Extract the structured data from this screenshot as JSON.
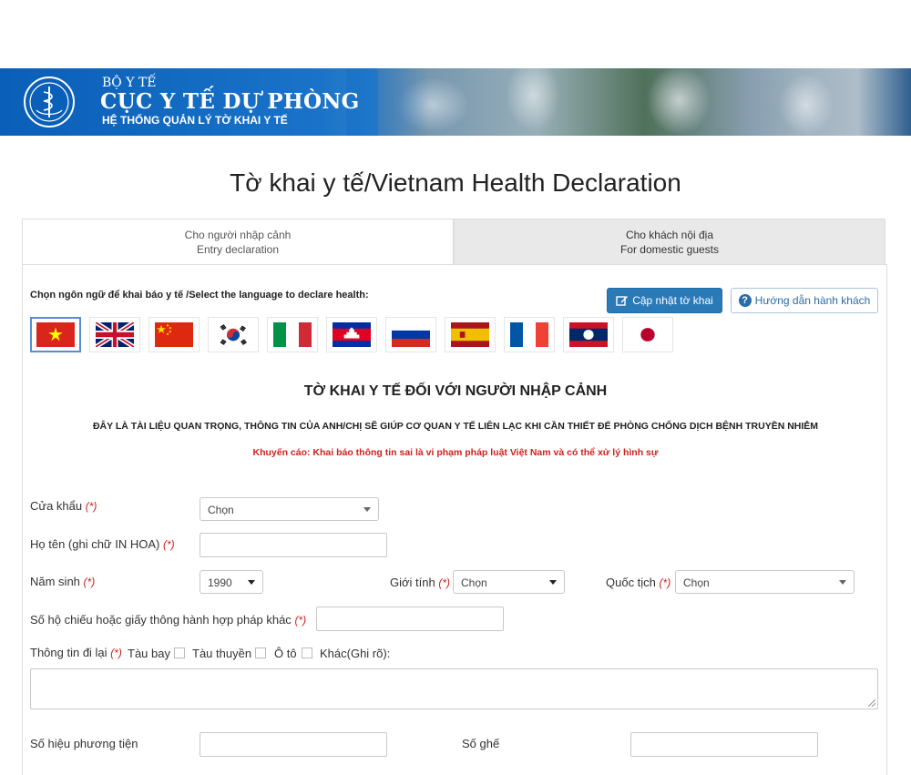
{
  "banner": {
    "ministry": "BỘ Y TẾ",
    "department": "CỤC Y TẾ DỰ PHÒNG",
    "system": "HỆ THỐNG QUẢN LÝ TỜ KHAI Y TẾ",
    "brand_color": "#1a73c8"
  },
  "page_title": "Tờ khai y tế/Vietnam Health Declaration",
  "tabs": [
    {
      "line1": "Cho người nhập cảnh",
      "line2": "Entry declaration",
      "active": true
    },
    {
      "line1": "Cho khách nội địa",
      "line2": "For domestic guests",
      "active": false
    }
  ],
  "language_label": "Chọn ngôn ngữ để khai báo y tế /Select the language to declare health:",
  "buttons": {
    "update": "Cập nhật tờ khai",
    "guide": "Hướng dẫn hành khách",
    "update_color": "#2a7ab8"
  },
  "flags": [
    "vietnam-flag-icon",
    "uk-flag-icon",
    "china-flag-icon",
    "korea-flag-icon",
    "italy-flag-icon",
    "cambodia-flag-icon",
    "russia-flag-icon",
    "spain-flag-icon",
    "france-flag-icon",
    "laos-flag-icon",
    "japan-flag-icon"
  ],
  "form": {
    "title": "TỜ KHAI Y TẾ ĐỐI VỚI NGƯỜI NHẬP CẢNH",
    "subtitle": "ĐÂY LÀ TÀI LIỆU QUAN TRỌNG, THÔNG TIN CỦA ANH/CHỊ SẼ GIÚP CƠ QUAN Y TẾ LIÊN LẠC KHI CẦN THIẾT ĐỂ PHÒNG CHỐNG DỊCH BỆNH TRUYỀN NHIỄM",
    "warning": "Khuyến cáo: Khai báo thông tin sai là vi phạm pháp luật Việt Nam và có thể xử lý hình sự",
    "required_mark": "(*)",
    "gate_label": "Cửa khẩu",
    "gate_value": "Chọn",
    "name_label": "Họ tên (ghi chữ IN HOA)",
    "dob_label": "Năm sinh",
    "dob_value": "1990",
    "gender_label": "Giới tính",
    "gender_value": "Chọn",
    "nationality_label": "Quốc tịch",
    "nationality_value": "Chọn",
    "passport_label": "Số hộ chiếu hoặc giấy thông hành hợp pháp khác",
    "travel_label": "Thông tin đi lại",
    "travel_options": [
      "Tàu bay",
      "Tàu thuyền",
      "Ô tô",
      "Khác(Ghi rõ):"
    ],
    "vehicle_label": "Số hiệu phương tiện",
    "seat_label": "Số ghế"
  }
}
